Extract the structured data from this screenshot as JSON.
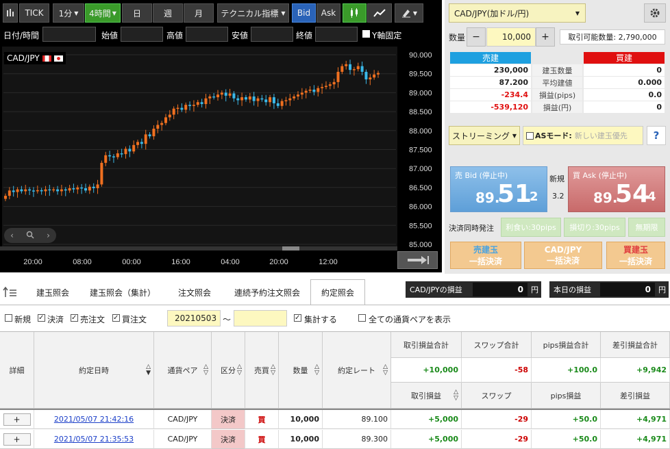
{
  "toolbar": {
    "tick": "TICK",
    "interval_1m": "1分",
    "interval_4h": "4時間",
    "day": "日",
    "week": "週",
    "month": "月",
    "technical": "テクニカル指標",
    "bid": "Bid",
    "ask": "Ask"
  },
  "ohlc": {
    "datetime": "日付/時間",
    "open": "始値",
    "high": "高値",
    "low": "安値",
    "close": "終値",
    "yaxis_fix": "Y軸固定"
  },
  "chart_data": {
    "type": "candlestick",
    "title": "CAD/JPY",
    "ylim": [
      85.0,
      90.0
    ],
    "y_ticks": [
      "90.000",
      "89.500",
      "89.000",
      "88.500",
      "88.000",
      "87.500",
      "87.000",
      "86.500",
      "86.000",
      "85.500",
      "85.000"
    ],
    "x_ticks": [
      "20:00",
      "08:00",
      "00:00",
      "16:00",
      "04:00",
      "20:00",
      "12:00"
    ],
    "close_values": [
      86.28,
      86.42,
      86.38,
      86.45,
      86.4,
      86.45,
      86.42,
      86.4,
      86.43,
      86.4,
      86.45,
      86.43,
      86.45,
      86.4,
      86.45,
      86.42,
      86.48,
      86.45,
      86.5,
      86.48,
      86.42,
      86.52,
      86.48,
      86.58,
      87.15,
      87.35,
      87.32,
      87.3,
      87.4,
      87.38,
      87.52,
      87.45,
      87.62,
      87.7,
      87.65,
      87.9,
      87.85,
      88.05,
      88.15,
      88.2,
      88.35,
      88.42,
      88.58,
      88.6,
      88.55,
      88.68,
      88.65,
      88.68,
      88.75,
      88.7,
      88.85,
      88.9,
      88.88,
      88.95,
      89.0,
      88.92,
      88.98,
      88.85,
      88.8,
      88.88,
      88.82,
      88.9,
      88.78,
      88.85,
      88.82,
      88.75,
      88.88,
      88.72,
      88.65,
      88.78,
      88.8,
      88.85,
      88.9,
      88.95,
      89.0,
      89.05,
      89.08,
      89.02,
      89.12,
      89.15,
      89.18,
      89.22,
      89.28,
      89.55,
      89.7,
      89.75,
      89.6,
      89.62,
      89.7,
      89.55,
      89.35,
      89.4,
      89.48,
      89.52
    ]
  },
  "pair": {
    "select": "CAD/JPY(加ドル/円)"
  },
  "order": {
    "qty_label": "数量",
    "minus": "−",
    "qty_value": "10,000",
    "plus": "+",
    "available": "取引可能数量: 2,790,000"
  },
  "positions": {
    "sell_header": "売建",
    "buy_header": "買建",
    "rows": [
      {
        "label": "建玉数量",
        "sell": "230,000",
        "buy": "0"
      },
      {
        "label": "平均建値",
        "sell": "87.200",
        "buy": "0.000"
      },
      {
        "label": "損益(pips)",
        "sell": "-234.4",
        "buy": "0.0"
      },
      {
        "label": "損益(円)",
        "sell": "-539,120",
        "buy": "0"
      }
    ]
  },
  "streaming": {
    "mode": "ストリーミング",
    "as_label": "ASモード:",
    "as_value": "新しい建玉優先",
    "help": "?"
  },
  "prices": {
    "bid_label": "売 Bid (停止中)",
    "bid_prefix": "89.",
    "bid_main": "51",
    "bid_suffix": "2",
    "ask_label": "買 Ask (停止中)",
    "ask_prefix": "89.",
    "ask_main": "54",
    "ask_suffix": "4",
    "new_label": "新規",
    "spread": "3.2"
  },
  "settle": {
    "label": "決済同時発注",
    "tp": "利食い:30pips",
    "sl": "損切り:30pips",
    "unlimited": "無期限"
  },
  "bulk": {
    "sell_l1": "売建玉",
    "sell_l2": "一括決済",
    "pair_l1": "CAD/JPY",
    "pair_l2": "一括決済",
    "buy_l1": "買建玉",
    "buy_l2": "一括決済"
  },
  "tabs": [
    "建玉照会",
    "建玉照会（集計）",
    "注文照会",
    "連続予約注文照会",
    "約定照会"
  ],
  "pnl": {
    "pair_label": "CAD/JPYの損益",
    "pair_value": "0",
    "unit": "円",
    "today_label": "本日の損益",
    "today_value": "0"
  },
  "filters": {
    "new": "新規",
    "settle": "決済",
    "sell": "売注文",
    "buy": "買注文",
    "date_from": "20210503",
    "tilde": "〜",
    "aggregate": "集計する",
    "all_pairs": "全ての通貨ペアを表示"
  },
  "table": {
    "headers": {
      "detail": "詳細",
      "datetime": "約定日時",
      "pair": "通貨ペア",
      "type": "区分",
      "side": "売買",
      "qty": "数量",
      "rate": "約定レート",
      "pl_total": "取引損益合計",
      "swap_total": "スワップ合計",
      "pips_total": "pips損益合計",
      "net_total": "差引損益合計",
      "pl": "取引損益",
      "swap": "スワップ",
      "pips": "pips損益",
      "net": "差引損益"
    },
    "totals": {
      "pl": "+10,000",
      "swap": "-58",
      "pips": "+100.0",
      "net": "+9,942"
    },
    "rows": [
      {
        "expand": "+",
        "datetime": "2021/05/07 21:42:16",
        "pair": "CAD/JPY",
        "type": "決済",
        "side": "買",
        "qty": "10,000",
        "rate": "89.100",
        "pl": "+5,000",
        "swap": "-29",
        "pips": "+50.0",
        "net": "+4,971"
      },
      {
        "expand": "+",
        "datetime": "2021/05/07 21:35:53",
        "pair": "CAD/JPY",
        "type": "決済",
        "side": "買",
        "qty": "10,000",
        "rate": "89.300",
        "pl": "+5,000",
        "swap": "-29",
        "pips": "+50.0",
        "net": "+4,971"
      }
    ]
  }
}
